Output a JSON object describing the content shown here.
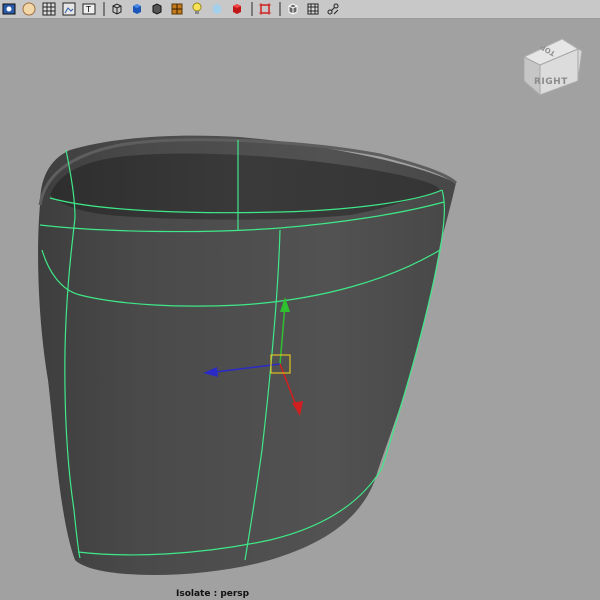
{
  "toolbar": {
    "icons": [
      "select-camera-icon",
      "camera-attributes-icon",
      "grid-icon",
      "image-plane-icon",
      "resolution-gate-icon",
      "wireframe-icon",
      "smooth-shade-icon",
      "shaded-wireframe-icon",
      "textured-icon",
      "use-all-lights-icon",
      "xray-icon",
      "backface-culling-icon",
      "isolate-select-icon",
      "wireframe-on-shaded-icon",
      "frame-all-icon",
      "joints-icon"
    ]
  },
  "view_cube": {
    "front_label": "RIGHT",
    "top_label": "TOP"
  },
  "viewport": {
    "camera_label": "Isolate : persp",
    "background_color": "#a1a1a1",
    "mesh_color": "#4d4d4d",
    "wire_color": "#3fe888"
  },
  "manipulator": {
    "x_axis_color": "#d11f1f",
    "y_axis_color": "#2fbf2f",
    "z_axis_color": "#2a2ac8",
    "center_color": "#e0c020"
  }
}
